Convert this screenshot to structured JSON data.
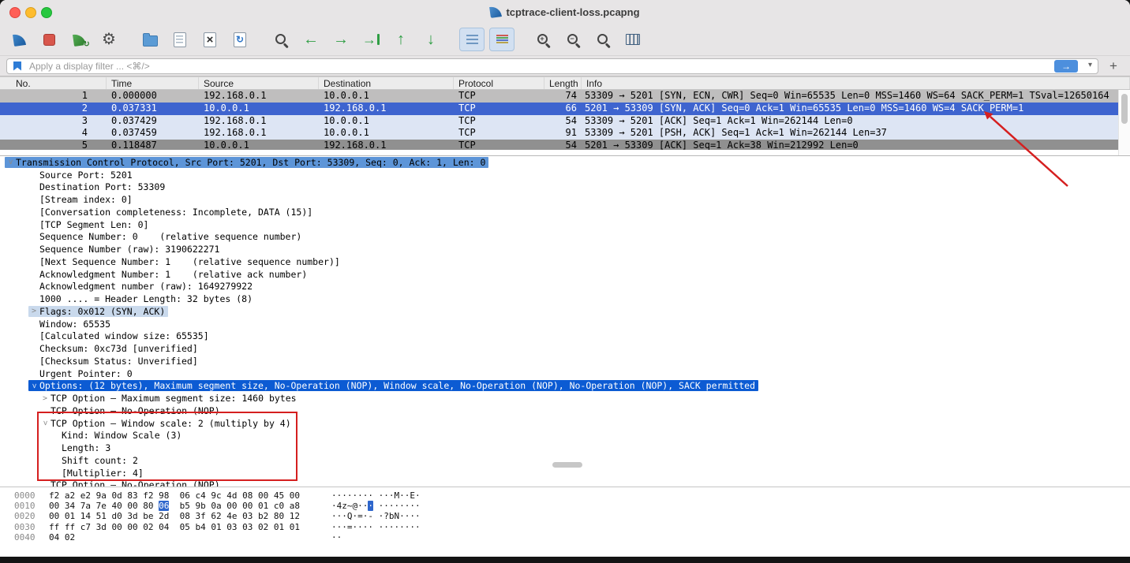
{
  "window": {
    "title": "tcptrace-client-loss.pcapng"
  },
  "toolbar": {
    "buttons": [
      {
        "name": "start-capture-button",
        "icon": "shark-fin-blue",
        "pressed": false
      },
      {
        "name": "stop-capture-button",
        "icon": "stop-square",
        "pressed": false
      },
      {
        "name": "restart-capture-button",
        "icon": "shark-fin-green",
        "pressed": false
      },
      {
        "name": "capture-options-button",
        "icon": "gear",
        "pressed": false
      },
      {
        "name": "open-file-button",
        "icon": "folder",
        "pressed": false
      },
      {
        "name": "save-file-button",
        "icon": "save-doc",
        "pressed": false
      },
      {
        "name": "close-file-button",
        "icon": "close-doc",
        "pressed": false
      },
      {
        "name": "reload-file-button",
        "icon": "reload-doc",
        "pressed": false
      },
      {
        "name": "find-packet-button",
        "icon": "magnifier",
        "pressed": false
      },
      {
        "name": "go-back-button",
        "icon": "arrow-left",
        "pressed": false
      },
      {
        "name": "go-forward-button",
        "icon": "arrow-right",
        "pressed": false
      },
      {
        "name": "go-to-packet-button",
        "icon": "arrow-goto",
        "pressed": false
      },
      {
        "name": "go-first-packet-button",
        "icon": "arrow-up",
        "pressed": false
      },
      {
        "name": "go-last-packet-button",
        "icon": "arrow-down",
        "pressed": false
      },
      {
        "name": "auto-scroll-button",
        "icon": "auto-scroll",
        "pressed": true
      },
      {
        "name": "colorize-button",
        "icon": "colorize",
        "pressed": true
      },
      {
        "name": "zoom-in-button",
        "icon": "zoom-in",
        "pressed": false
      },
      {
        "name": "zoom-out-button",
        "icon": "zoom-out",
        "pressed": false
      },
      {
        "name": "zoom-reset-button",
        "icon": "zoom-reset",
        "pressed": false
      },
      {
        "name": "resize-columns-button",
        "icon": "resize-columns",
        "pressed": false
      }
    ]
  },
  "filter": {
    "placeholder": "Apply a display filter ... <⌘/>",
    "apply_label": "→",
    "dropdown_label": "▾",
    "add_label": "+"
  },
  "packet_list": {
    "columns": [
      "No.",
      "Time",
      "Source",
      "Destination",
      "Protocol",
      "Length",
      "Info"
    ],
    "rows": [
      {
        "no": "1",
        "time": "0.000000",
        "source": "192.168.0.1",
        "destination": "10.0.0.1",
        "protocol": "TCP",
        "length": "74",
        "info": "53309 → 5201 [SYN, ECN, CWR] Seq=0 Win=65535 Len=0 MSS=1460 WS=64 SACK_PERM=1 TSval=12650164",
        "color": "gray"
      },
      {
        "no": "2",
        "time": "0.037331",
        "source": "10.0.0.1",
        "destination": "192.168.0.1",
        "protocol": "TCP",
        "length": "66",
        "info": "5201 → 53309 [SYN, ACK] Seq=0 Ack=1 Win=65535 Len=0 MSS=1460 WS=4 SACK_PERM=1",
        "color": "selected"
      },
      {
        "no": "3",
        "time": "0.037429",
        "source": "192.168.0.1",
        "destination": "10.0.0.1",
        "protocol": "TCP",
        "length": "54",
        "info": "53309 → 5201 [ACK] Seq=1 Ack=1 Win=262144 Len=0",
        "color": "light"
      },
      {
        "no": "4",
        "time": "0.037459",
        "source": "192.168.0.1",
        "destination": "10.0.0.1",
        "protocol": "TCP",
        "length": "91",
        "info": "53309 → 5201 [PSH, ACK] Seq=1 Ack=1 Win=262144 Len=37",
        "color": "light"
      },
      {
        "no": "5",
        "time": "0.118487",
        "source": "10.0.0.1",
        "destination": "192.168.0.1",
        "protocol": "TCP",
        "length": "54",
        "info": "5201 → 53309 [ACK] Seq=1 Ack=38 Win=212992 Len=0",
        "color": "gray-clipped"
      }
    ]
  },
  "details": {
    "lines": [
      {
        "text": "Transmission Control Protocol, Src Port: 5201, Dst Port: 53309, Seq: 0, Ack: 1, Len: 0",
        "indent": 0,
        "chevron": "down",
        "style": "summary-selected"
      },
      {
        "text": "Source Port: 5201",
        "indent": 1,
        "chevron": "none",
        "style": "plain"
      },
      {
        "text": "Destination Port: 53309",
        "indent": 1,
        "chevron": "none",
        "style": "plain"
      },
      {
        "text": "[Stream index: 0]",
        "indent": 1,
        "chevron": "none",
        "style": "plain"
      },
      {
        "text": "[Conversation completeness: Incomplete, DATA (15)]",
        "indent": 1,
        "chevron": "none",
        "style": "plain"
      },
      {
        "text": "[TCP Segment Len: 0]",
        "indent": 1,
        "chevron": "none",
        "style": "plain"
      },
      {
        "text": "Sequence Number: 0    (relative sequence number)",
        "indent": 1,
        "chevron": "none",
        "style": "plain"
      },
      {
        "text": "Sequence Number (raw): 3190622271",
        "indent": 1,
        "chevron": "none",
        "style": "plain"
      },
      {
        "text": "[Next Sequence Number: 1    (relative sequence number)]",
        "indent": 1,
        "chevron": "none",
        "style": "plain"
      },
      {
        "text": "Acknowledgment Number: 1    (relative ack number)",
        "indent": 1,
        "chevron": "none",
        "style": "plain"
      },
      {
        "text": "Acknowledgment number (raw): 1649279922",
        "indent": 1,
        "chevron": "none",
        "style": "plain"
      },
      {
        "text": "1000 .... = Header Length: 32 bytes (8)",
        "indent": 1,
        "chevron": "none",
        "style": "plain"
      },
      {
        "text": "Flags: 0x012 (SYN, ACK)",
        "indent": 1,
        "chevron": "right",
        "style": "field-highlight"
      },
      {
        "text": "Window: 65535",
        "indent": 1,
        "chevron": "none",
        "style": "plain"
      },
      {
        "text": "[Calculated window size: 65535]",
        "indent": 1,
        "chevron": "none",
        "style": "plain"
      },
      {
        "text": "Checksum: 0xc73d [unverified]",
        "indent": 1,
        "chevron": "none",
        "style": "plain"
      },
      {
        "text": "[Checksum Status: Unverified]",
        "indent": 1,
        "chevron": "none",
        "style": "plain"
      },
      {
        "text": "Urgent Pointer: 0",
        "indent": 1,
        "chevron": "none",
        "style": "plain"
      },
      {
        "text": "Options: (12 bytes), Maximum segment size, No-Operation (NOP), Window scale, No-Operation (NOP), No-Operation (NOP), SACK permitted",
        "indent": 1,
        "chevron": "down",
        "style": "selected"
      },
      {
        "text": "TCP Option – Maximum segment size: 1460 bytes",
        "indent": 2,
        "chevron": "right",
        "style": "plain"
      },
      {
        "text": "TCP Option – No-Operation (NOP)",
        "indent": 2,
        "chevron": "none",
        "style": "plain"
      },
      {
        "text": "TCP Option – Window scale: 2 (multiply by 4)",
        "indent": 2,
        "chevron": "down",
        "style": "plain"
      },
      {
        "text": "Kind: Window Scale (3)",
        "indent": 3,
        "chevron": "none",
        "style": "plain"
      },
      {
        "text": "Length: 3",
        "indent": 3,
        "chevron": "none",
        "style": "plain"
      },
      {
        "text": "Shift count: 2",
        "indent": 3,
        "chevron": "none",
        "style": "plain"
      },
      {
        "text": "[Multiplier: 4]",
        "indent": 3,
        "chevron": "none",
        "style": "plain"
      },
      {
        "text": "TCP Option – No-Operation (NOP)",
        "indent": 2,
        "chevron": "none",
        "style": "plain"
      }
    ]
  },
  "hex": {
    "rows": [
      {
        "offset": "0000",
        "g1": [
          "f2",
          "a2",
          "e2",
          "9a",
          "0d",
          "83",
          "f2",
          "98"
        ],
        "g2": [
          "06",
          "c4",
          "9c",
          "4d",
          "08",
          "00",
          "45",
          "00"
        ],
        "a1": "········",
        "a2": "···M··E·"
      },
      {
        "offset": "0010",
        "g1": [
          "00",
          "34",
          "7a",
          "7e",
          "40",
          "00",
          "80",
          "06"
        ],
        "g2": [
          "b5",
          "9b",
          "0a",
          "00",
          "00",
          "01",
          "c0",
          "a8"
        ],
        "a1": "·4z~@···",
        "a2": "········"
      },
      {
        "offset": "0020",
        "g1": [
          "00",
          "01",
          "14",
          "51",
          "d0",
          "3d",
          "be",
          "2d"
        ],
        "g2": [
          "08",
          "3f",
          "62",
          "4e",
          "03",
          "b2",
          "80",
          "12"
        ],
        "a1": "···Q·=·-",
        "a2": "·?bN····"
      },
      {
        "offset": "0030",
        "g1": [
          "ff",
          "ff",
          "c7",
          "3d",
          "00",
          "00",
          "02",
          "04"
        ],
        "g2": [
          "05",
          "b4",
          "01",
          "03",
          "03",
          "02",
          "01",
          "01"
        ],
        "a1": "···=····",
        "a2": "········"
      },
      {
        "offset": "0040",
        "g1": [
          "04",
          "02"
        ],
        "g2": [],
        "a1": "··",
        "a2": ""
      }
    ],
    "highlight": {
      "row": 1,
      "group": 1,
      "index": 7
    }
  },
  "annotations": {
    "color": "#d51f1f"
  }
}
